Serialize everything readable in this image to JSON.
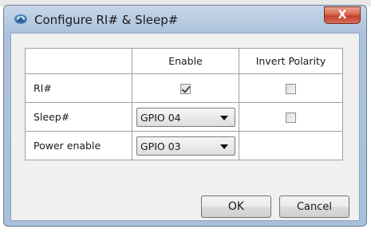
{
  "window": {
    "title": "Configure RI# & Sleep#",
    "close_glyph": "X"
  },
  "grid": {
    "headers": [
      "",
      "Enable",
      "Invert Polarity"
    ],
    "rows": [
      {
        "label": "RI#",
        "enable": {
          "type": "checkbox",
          "checked": true
        },
        "invert": {
          "type": "checkbox",
          "checked": false
        }
      },
      {
        "label": "Sleep#",
        "enable": {
          "type": "dropdown",
          "value": "GPIO 04"
        },
        "invert": {
          "type": "checkbox",
          "checked": false
        }
      },
      {
        "label": "Power enable",
        "enable": {
          "type": "dropdown",
          "value": "GPIO 03"
        },
        "invert": {
          "type": "none"
        }
      }
    ]
  },
  "buttons": {
    "ok": "OK",
    "cancel": "Cancel"
  },
  "colors": {
    "close_button": "#d8684f",
    "title_bar": "#b7cbe2"
  }
}
